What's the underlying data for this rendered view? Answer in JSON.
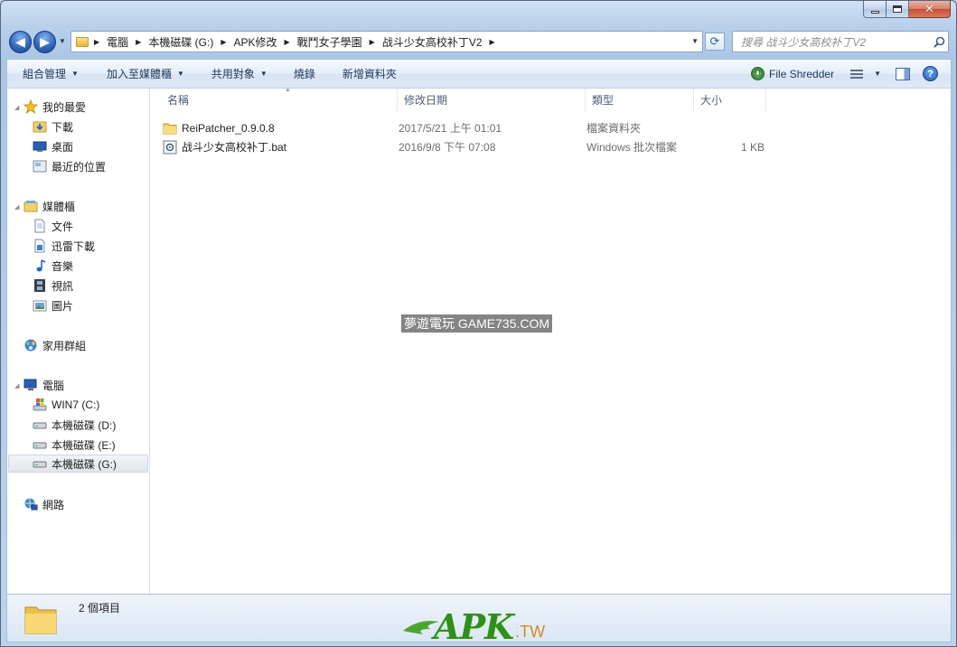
{
  "window": {
    "close_glyph": "✕"
  },
  "nav": {
    "back_glyph": "◀",
    "forward_glyph": "▶",
    "breadcrumbs": [
      "電腦",
      "本機磁碟 (G:)",
      "APK修改",
      "戰鬥女子學園",
      "战斗少女高校补丁V2"
    ],
    "refresh_glyph": "⟳",
    "search_placeholder": "搜尋 战斗少女高校补丁V2"
  },
  "toolbar": {
    "organize": "組合管理",
    "include_library": "加入至媒體櫃",
    "share_with": "共用對象",
    "burn": "燒錄",
    "new_folder": "新增資料夾",
    "file_shredder": "File Shredder",
    "help_glyph": "?"
  },
  "sidebar": {
    "favorites": {
      "label": "我的最愛",
      "items": [
        "下載",
        "桌面",
        "最近的位置"
      ]
    },
    "libraries": {
      "label": "媒體櫃",
      "items": [
        "文件",
        "迅雷下載",
        "音樂",
        "視訊",
        "圖片"
      ]
    },
    "homegroup": "家用群組",
    "computer": {
      "label": "電腦",
      "items": [
        "WIN7 (C:)",
        "本機磁碟 (D:)",
        "本機磁碟 (E:)",
        "本機磁碟 (G:)"
      ],
      "selected": "本機磁碟 (G:)"
    },
    "network": "網路"
  },
  "columns": {
    "name": "名稱",
    "modified": "修改日期",
    "type": "類型",
    "size": "大小"
  },
  "files": [
    {
      "name": "ReiPatcher_0.9.0.8",
      "modified": "2017/5/21 上午 01:01",
      "type": "檔案資料夾",
      "size": "",
      "icon": "folder-icon"
    },
    {
      "name": "战斗少女高校补丁.bat",
      "modified": "2016/9/8 下午 07:08",
      "type": "Windows 批次檔案",
      "size": "1 KB",
      "icon": "batch-file-icon"
    }
  ],
  "status": {
    "item_count": "2 個項目"
  },
  "watermarks": {
    "site_label": "夢遊電玩 GAME735.COM",
    "logo_main": "APK",
    "logo_tld": ".TW"
  }
}
